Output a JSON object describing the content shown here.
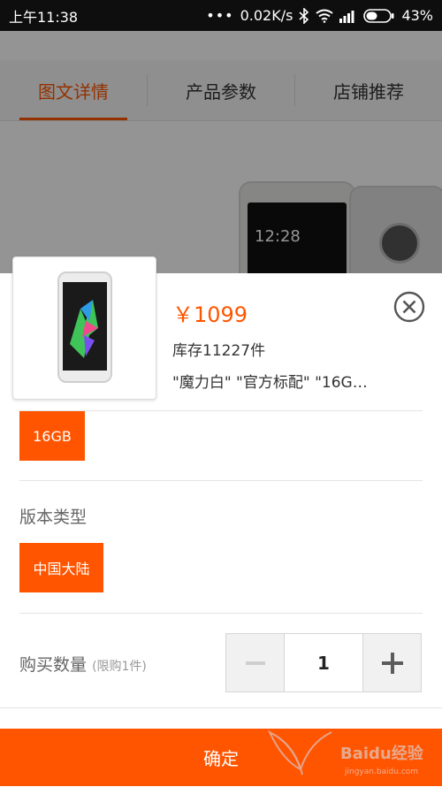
{
  "status_bar": {
    "time": "上午11:38",
    "net_speed": "0.02K/s",
    "battery": "43%"
  },
  "background_page": {
    "tabs": [
      {
        "label": "图文详情",
        "active": true
      },
      {
        "label": "产品参数",
        "active": false
      },
      {
        "label": "店铺推荐",
        "active": false
      }
    ],
    "phone_time": "12:28"
  },
  "sheet": {
    "price": "￥1099",
    "stock": "库存11227件",
    "selected_spec": "\"魔力白\" \"官方标配\" \"16G…",
    "storage_option": "16GB",
    "version_title": "版本类型",
    "version_option": "中国大陆",
    "quantity_label": "购买数量",
    "quantity_note": "(限购1件)",
    "quantity_value": "1",
    "confirm_label": "确定"
  },
  "watermark": {
    "text": "Baidu经验",
    "sub": "jingyan.baidu.com"
  },
  "colors": {
    "accent": "#ff5500",
    "overlay": "rgba(0,0,0,0.42)"
  },
  "icons": [
    "more-dots-icon",
    "bluetooth-icon",
    "wifi-icon",
    "signal-icon",
    "battery-icon",
    "close-circle-icon",
    "minus-icon",
    "plus-icon"
  ]
}
